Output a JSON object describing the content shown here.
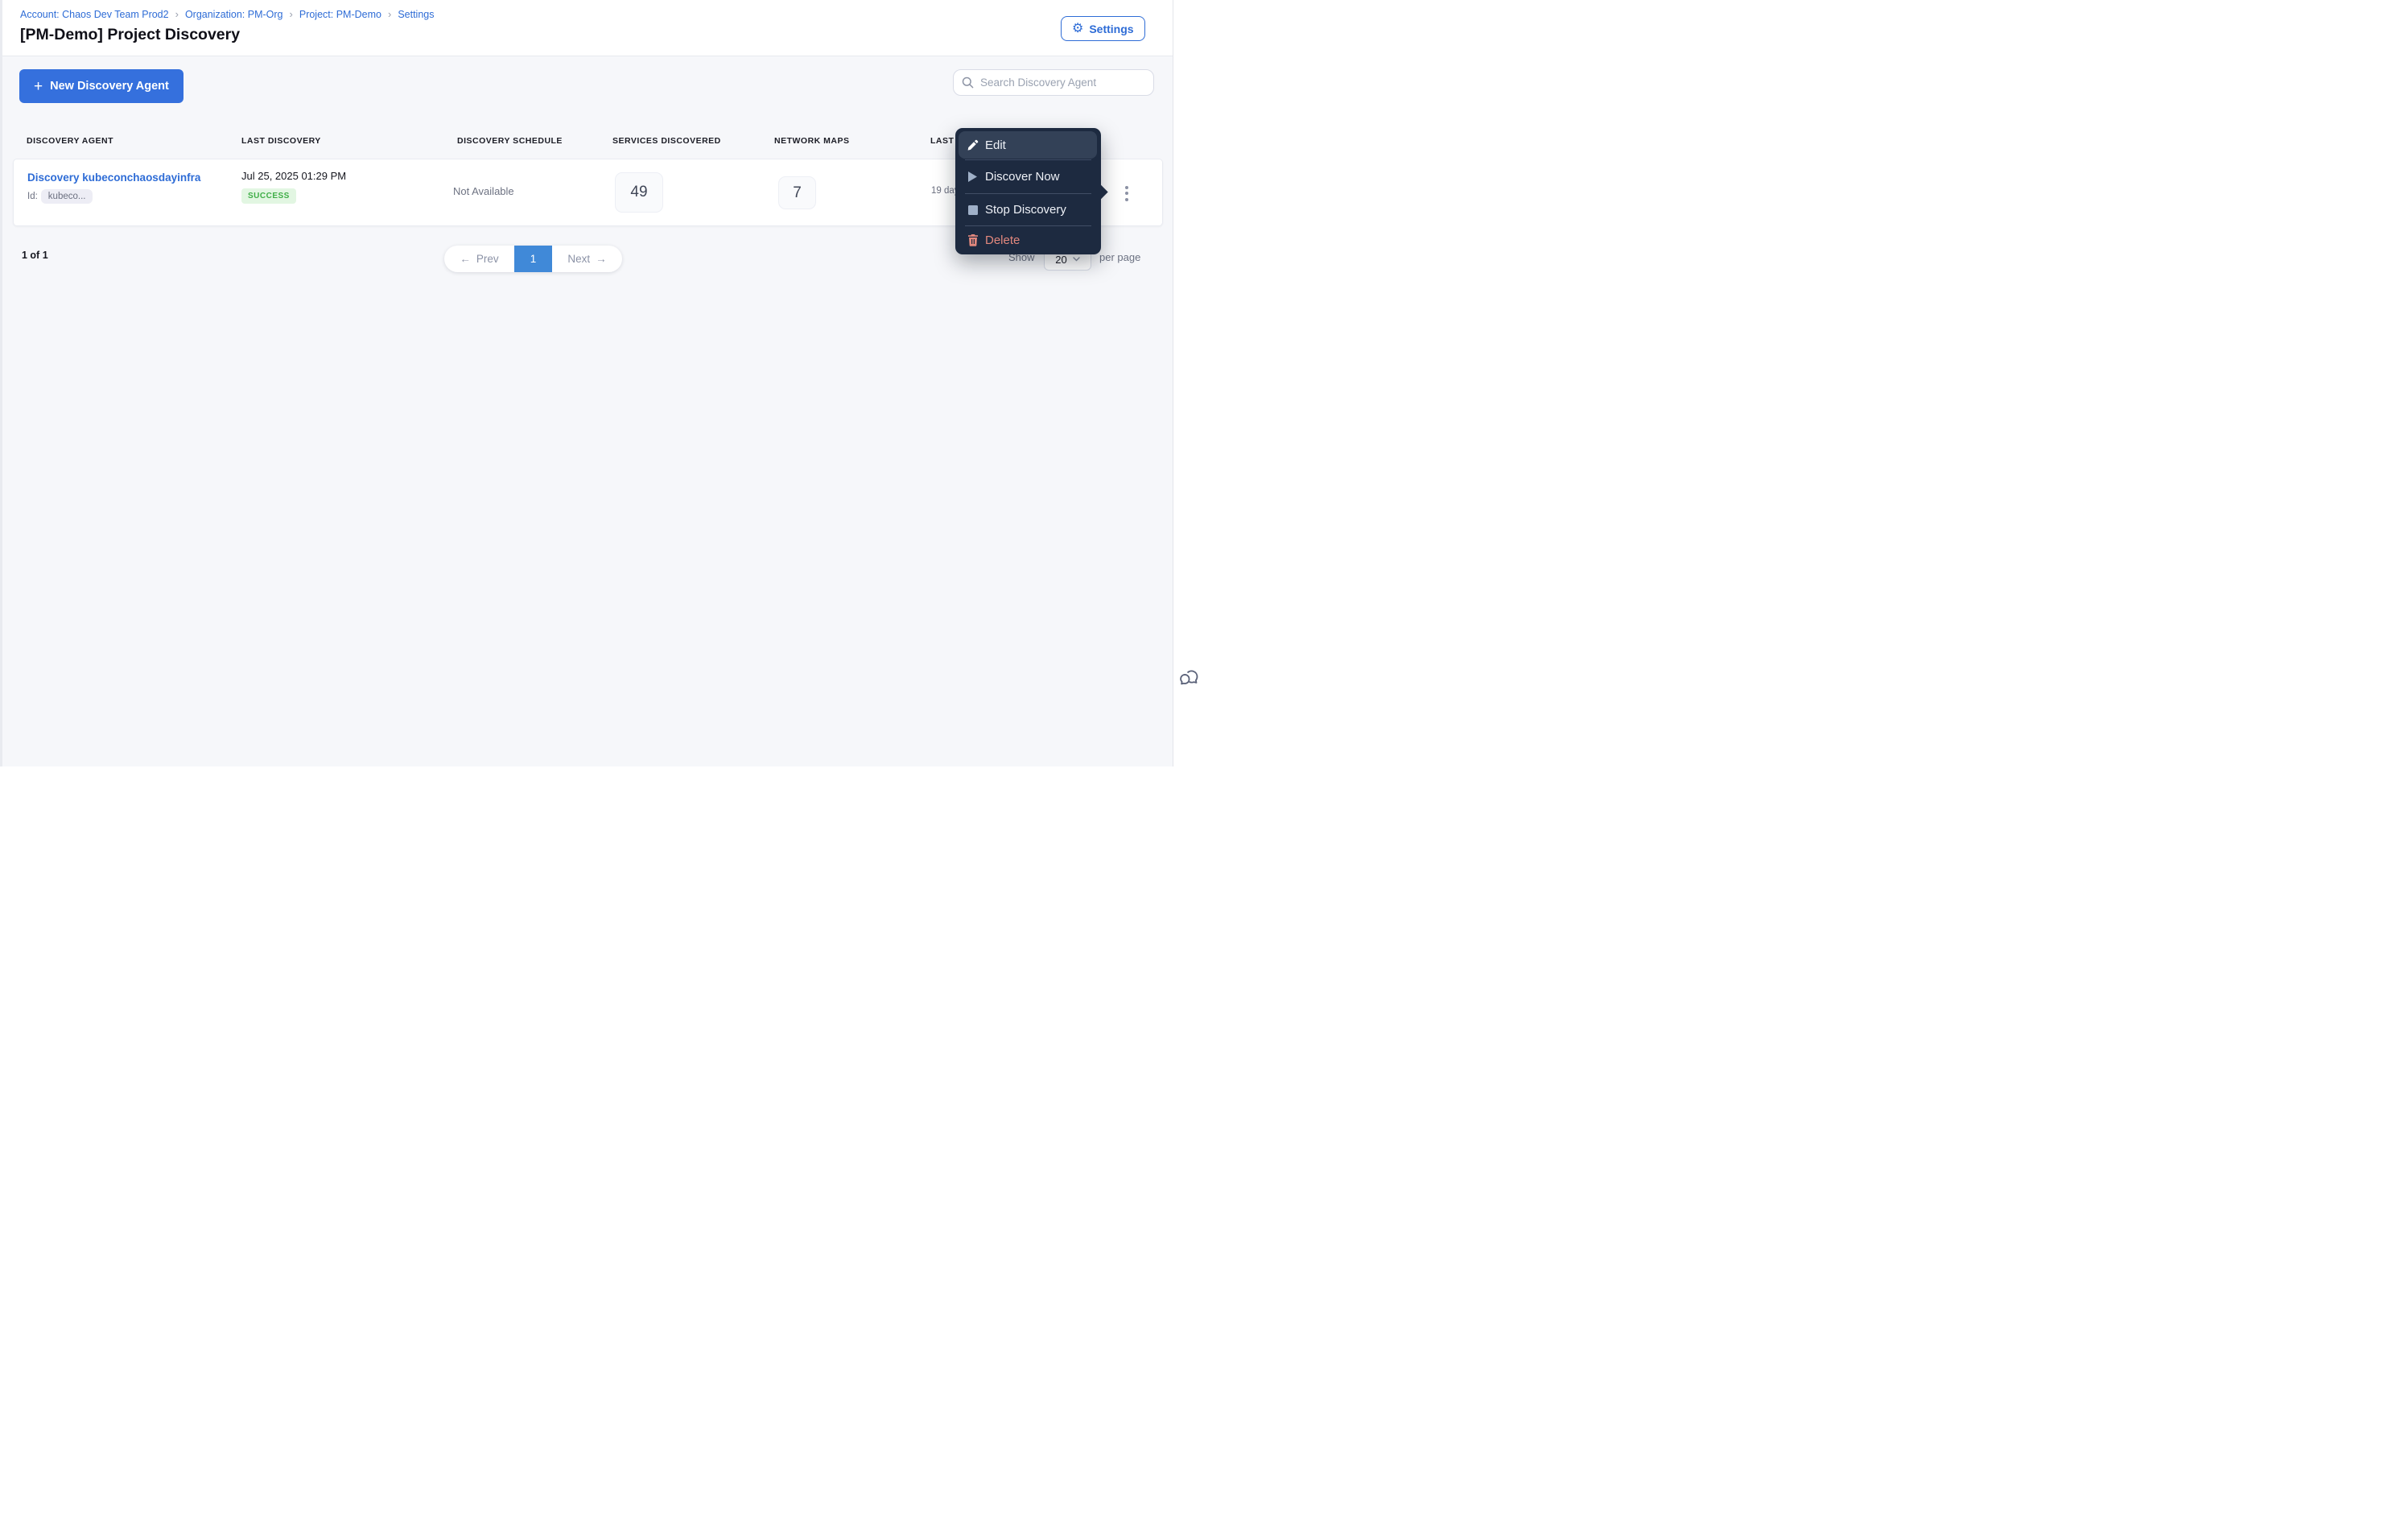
{
  "breadcrumb": {
    "separator": "›",
    "items": [
      {
        "label": "Account: Chaos Dev Team Prod2"
      },
      {
        "label": "Organization: PM-Org"
      },
      {
        "label": "Project: PM-Demo"
      },
      {
        "label": "Settings"
      }
    ]
  },
  "header": {
    "title": "[PM-Demo] Project Discovery",
    "settings_button_label": "Settings"
  },
  "icons": {
    "gear": "⚙",
    "plus": "+"
  },
  "toolbar": {
    "new_agent_button_label": "New Discovery Agent",
    "search_placeholder": "Search Discovery Agent"
  },
  "table": {
    "columns": [
      "DISCOVERY AGENT",
      "LAST DISCOVERY",
      "DISCOVERY SCHEDULE",
      "SERVICES DISCOVERED",
      "NETWORK MAPS",
      "LAST"
    ],
    "row": {
      "agent_name": "Discovery kubeconchaosdayinfra",
      "id_label": "Id:",
      "id_value": "kubeco...",
      "last_discovery_date": "Jul 25, 2025 01:29 PM",
      "status": "SUCCESS",
      "discovery_schedule": "Not Available",
      "services_discovered": "49",
      "network_maps": "7",
      "last_text": "19 day"
    }
  },
  "context_menu": {
    "items": [
      {
        "label": "Edit",
        "icon": "pencil-icon",
        "highlighted": true
      },
      {
        "label": "Discover Now",
        "icon": "play-icon",
        "highlighted": false
      },
      {
        "label": "Stop Discovery",
        "icon": "stop-icon",
        "highlighted": false
      },
      {
        "label": "Delete",
        "icon": "trash-icon",
        "highlighted": false
      }
    ]
  },
  "pagination": {
    "summary": "1 of 1",
    "prev_arrow": "←",
    "prev_label": "Prev",
    "current_page": "1",
    "next_label": "Next",
    "next_arrow": "→",
    "show_label": "Show",
    "page_size": "20",
    "per_page_label": "per page"
  },
  "colors": {
    "primary_blue": "#3570dd",
    "link_blue": "#2e6cd6",
    "success_green": "#3fae47",
    "success_bg": "#e2f6e2",
    "menu_bg": "#1d2a40",
    "menu_highlight": "#334157",
    "danger": "#e2887d",
    "page_bg": "#f6f7fa",
    "pager_active_blue": "#4089d8"
  }
}
